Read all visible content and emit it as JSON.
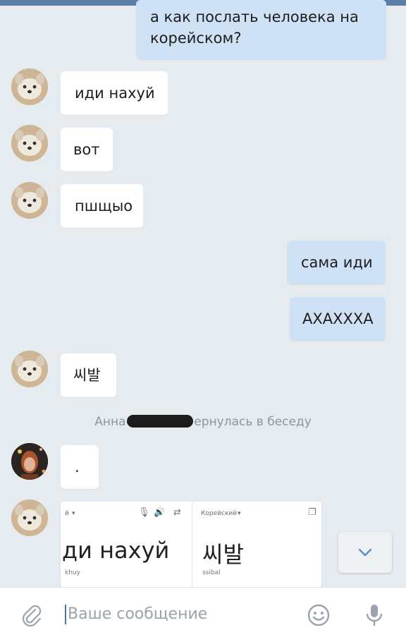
{
  "messages": [
    {
      "id": "m1",
      "text": "а как послать человека на корейском?"
    },
    {
      "id": "m2",
      "text": "иди нахуй"
    },
    {
      "id": "m3",
      "text": "вот"
    },
    {
      "id": "m4",
      "text": "пшщыо"
    },
    {
      "id": "m5",
      "text": "сама иди"
    },
    {
      "id": "m6",
      "text": "АХАХХХА"
    },
    {
      "id": "m7",
      "text": "씨발"
    },
    {
      "id": "m8",
      "text": "."
    }
  ],
  "system_message": {
    "name": "Анна",
    "text": "ернулась в беседу"
  },
  "translator": {
    "source_lang": "й",
    "target_lang": "Корейский",
    "source_text": "ди нахуй",
    "source_translit": "khuy",
    "target_text": "씨발",
    "target_translit": "ssibal"
  },
  "composer": {
    "placeholder": "Ваше сообщение"
  },
  "colors": {
    "incoming": "#ffffff",
    "outgoing": "#cfe2f5",
    "background": "#e6ebf0",
    "accent": "#4a76a8"
  },
  "icons": [
    "paperclip-icon",
    "emoji-icon",
    "microphone-icon",
    "chevron-down-icon"
  ]
}
